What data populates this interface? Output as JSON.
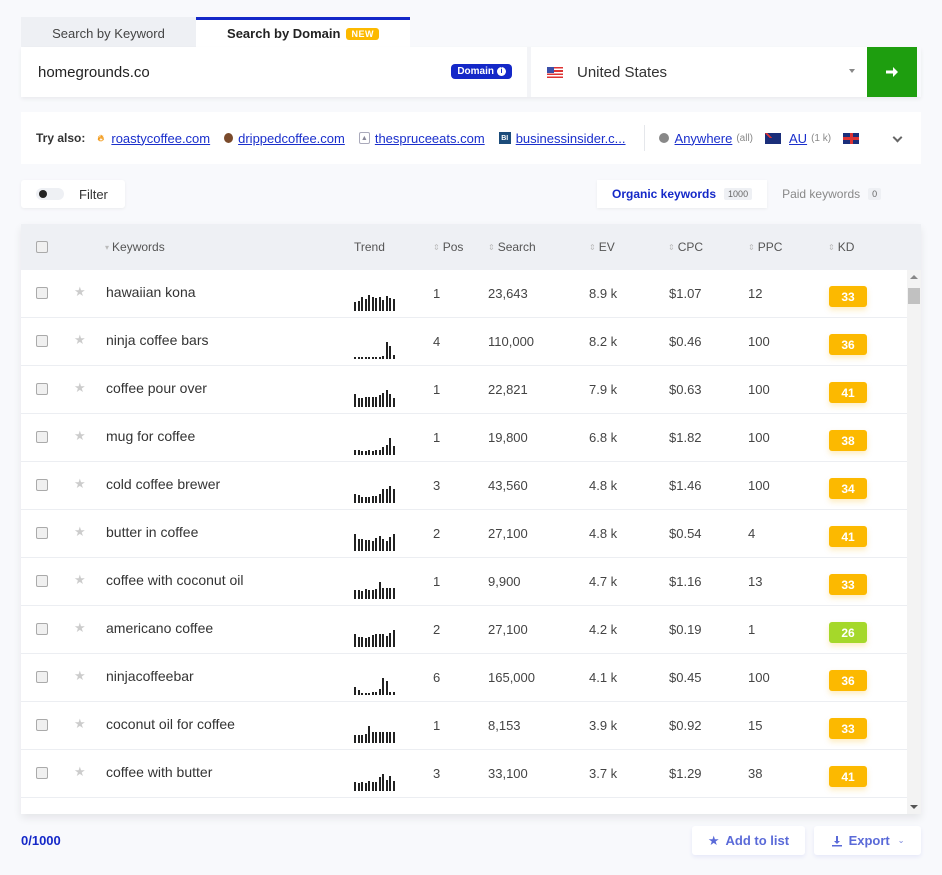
{
  "tabs": [
    {
      "label": "Search by Keyword",
      "active": false
    },
    {
      "label": "Search by Domain",
      "active": true,
      "badge": "NEW"
    }
  ],
  "search": {
    "domain_value": "homegrounds.co",
    "domain_badge": "Domain",
    "country": "United States",
    "go_icon": "arrow-right-icon"
  },
  "try_also": {
    "label": "Try also:",
    "domains": [
      {
        "name": "roastycoffee.com",
        "icon": "fire-icon"
      },
      {
        "name": "drippedcoffee.com",
        "icon": "cup-icon"
      },
      {
        "name": "thespruceeats.com",
        "icon": "spruce-icon"
      },
      {
        "name": "businessinsider.c...",
        "icon": "bi-icon"
      }
    ],
    "locations": [
      {
        "name": "Anywhere",
        "count": "(all)",
        "icon": "globe-icon"
      },
      {
        "name": "AU",
        "count": "(1 k)",
        "icon": "flag-au-icon"
      }
    ]
  },
  "filter": {
    "label": "Filter",
    "enabled": false
  },
  "keyword_tabs": [
    {
      "label": "Organic keywords",
      "count": "1000",
      "active": true
    },
    {
      "label": "Paid keywords",
      "count": "0",
      "active": false
    }
  ],
  "table": {
    "columns": {
      "keywords": "Keywords",
      "trend": "Trend",
      "pos": "Pos",
      "search": "Search",
      "ev": "EV",
      "cpc": "CPC",
      "ppc": "PPC",
      "kd": "KD"
    },
    "rows": [
      {
        "keyword": "hawaiian kona",
        "pos": "1",
        "search": "23,643",
        "ev": "8.9 k",
        "cpc": "$1.07",
        "ppc": "12",
        "kd": "33",
        "trend": [
          0.5,
          0.6,
          0.85,
          0.7,
          0.95,
          0.8,
          0.75,
          0.8,
          0.65,
          0.9,
          0.75,
          0.7
        ]
      },
      {
        "keyword": "ninja coffee bars",
        "pos": "4",
        "search": "110,000",
        "ev": "8.2 k",
        "cpc": "$0.46",
        "ppc": "100",
        "kd": "36",
        "trend": [
          0.12,
          0.12,
          0.12,
          0.1,
          0.1,
          0.1,
          0.1,
          0.12,
          0.15,
          1.0,
          0.75,
          0.25
        ]
      },
      {
        "keyword": "coffee pour over",
        "pos": "1",
        "search": "22,821",
        "ev": "7.9 k",
        "cpc": "$0.63",
        "ppc": "100",
        "kd": "41",
        "trend": [
          0.75,
          0.55,
          0.55,
          0.6,
          0.6,
          0.6,
          0.6,
          0.7,
          0.85,
          1.0,
          0.75,
          0.55
        ]
      },
      {
        "keyword": "mug for coffee",
        "pos": "1",
        "search": "19,800",
        "ev": "6.8 k",
        "cpc": "$1.82",
        "ppc": "100",
        "kd": "38",
        "trend": [
          0.3,
          0.3,
          0.25,
          0.25,
          0.3,
          0.25,
          0.3,
          0.3,
          0.45,
          0.6,
          1.0,
          0.55
        ]
      },
      {
        "keyword": "cold coffee brewer",
        "pos": "3",
        "search": "43,560",
        "ev": "4.8 k",
        "cpc": "$1.46",
        "ppc": "100",
        "kd": "34",
        "trend": [
          0.5,
          0.45,
          0.35,
          0.35,
          0.35,
          0.4,
          0.4,
          0.5,
          0.85,
          0.85,
          1.0,
          0.85
        ]
      },
      {
        "keyword": "butter in coffee",
        "pos": "2",
        "search": "27,100",
        "ev": "4.8 k",
        "cpc": "$0.54",
        "ppc": "4",
        "kd": "41",
        "trend": [
          1.0,
          0.7,
          0.7,
          0.65,
          0.65,
          0.6,
          0.75,
          0.9,
          0.7,
          0.6,
          0.8,
          1.0
        ]
      },
      {
        "keyword": "coffee with coconut oil",
        "pos": "1",
        "search": "9,900",
        "ev": "4.7 k",
        "cpc": "$1.16",
        "ppc": "13",
        "kd": "33",
        "trend": [
          0.5,
          0.5,
          0.45,
          0.6,
          0.5,
          0.5,
          0.6,
          1.0,
          0.65,
          0.65,
          0.65,
          0.65
        ]
      },
      {
        "keyword": "americano coffee",
        "pos": "2",
        "search": "27,100",
        "ev": "4.2 k",
        "cpc": "$0.19",
        "ppc": "1",
        "kd": "26",
        "trend": [
          0.75,
          0.6,
          0.6,
          0.55,
          0.6,
          0.7,
          0.75,
          0.75,
          0.75,
          0.65,
          0.85,
          1.0
        ]
      },
      {
        "keyword": "ninjacoffeebar",
        "pos": "6",
        "search": "165,000",
        "ev": "4.1 k",
        "cpc": "$0.45",
        "ppc": "100",
        "kd": "36",
        "trend": [
          0.45,
          0.3,
          0.1,
          0.1,
          0.1,
          0.15,
          0.15,
          0.35,
          1.0,
          0.85,
          0.2,
          0.15
        ]
      },
      {
        "keyword": "coconut oil for coffee",
        "pos": "1",
        "search": "8,153",
        "ev": "3.9 k",
        "cpc": "$0.92",
        "ppc": "15",
        "kd": "33",
        "trend": [
          0.45,
          0.45,
          0.45,
          0.55,
          1.0,
          0.65,
          0.65,
          0.65,
          0.65,
          0.65,
          0.65,
          0.65
        ]
      },
      {
        "keyword": "coffee with butter",
        "pos": "3",
        "search": "33,100",
        "ev": "3.7 k",
        "cpc": "$1.29",
        "ppc": "38",
        "kd": "41",
        "trend": [
          0.5,
          0.45,
          0.5,
          0.45,
          0.6,
          0.5,
          0.55,
          0.85,
          1.0,
          0.65,
          0.9,
          0.6
        ]
      }
    ]
  },
  "kd_colors": {
    "medium": "#fcb900",
    "easy": "#a5d82a"
  },
  "footer": {
    "selection": "0/1000",
    "add_to_list": "Add to list",
    "export": "Export"
  }
}
